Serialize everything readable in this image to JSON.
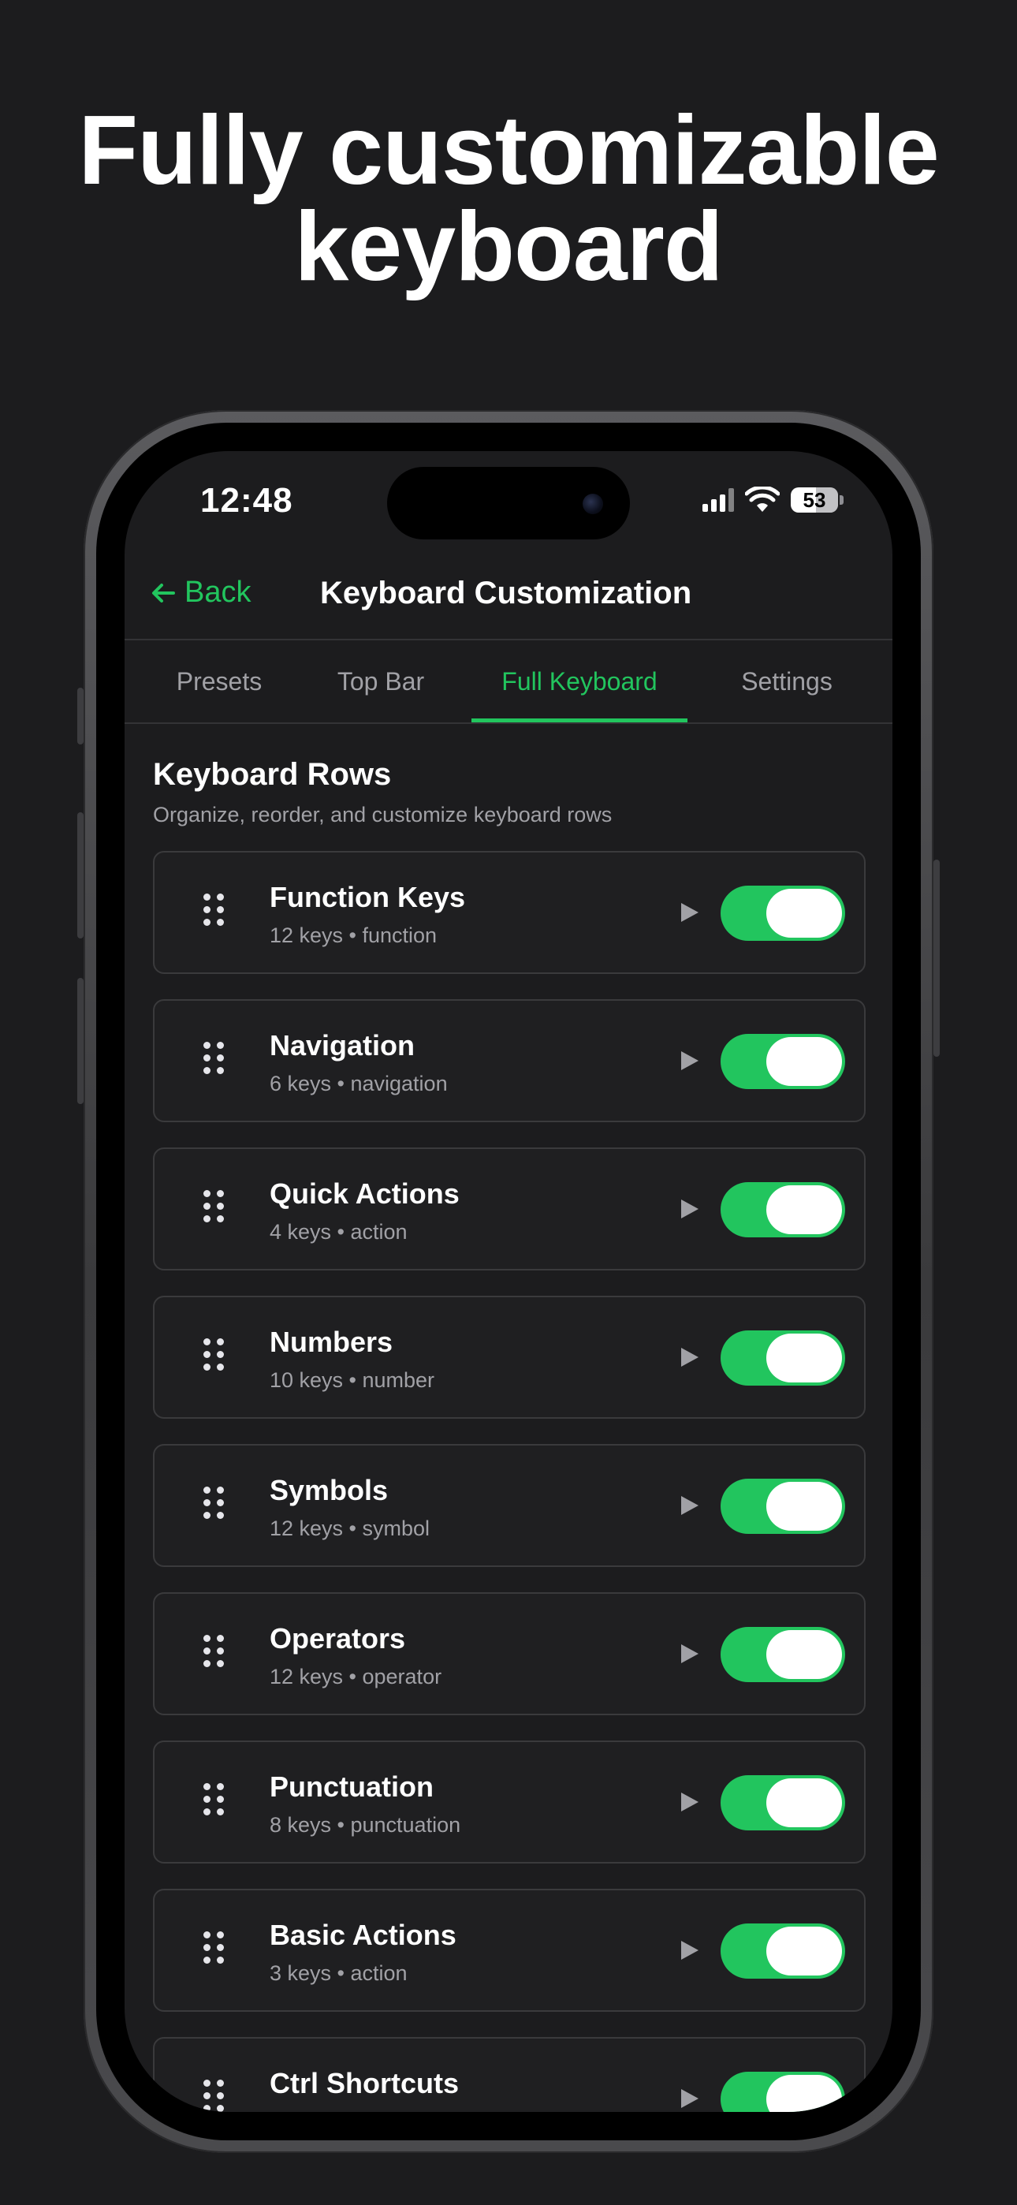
{
  "headline": {
    "line1": "Fully customizable",
    "line2": "keyboard"
  },
  "status_bar": {
    "time": "12:48",
    "battery": "53"
  },
  "nav": {
    "back_label": "Back",
    "back_icon": "arrow-left-icon",
    "title": "Keyboard Customization"
  },
  "tabs": [
    {
      "label": "Presets"
    },
    {
      "label": "Top Bar"
    },
    {
      "label": "Full Keyboard"
    },
    {
      "label": "Settings"
    }
  ],
  "active_tab": "Full Keyboard",
  "section": {
    "title": "Keyboard Rows",
    "subtitle": "Organize, reorder, and customize keyboard rows"
  },
  "rows": [
    {
      "name": "Function Keys",
      "meta": "12 keys • function",
      "enabled": true
    },
    {
      "name": "Navigation",
      "meta": "6 keys • navigation",
      "enabled": true
    },
    {
      "name": "Quick Actions",
      "meta": "4 keys • action",
      "enabled": true
    },
    {
      "name": "Numbers",
      "meta": "10 keys • number",
      "enabled": true
    },
    {
      "name": "Symbols",
      "meta": "12 keys • symbol",
      "enabled": true
    },
    {
      "name": "Operators",
      "meta": "12 keys • operator",
      "enabled": true
    },
    {
      "name": "Punctuation",
      "meta": "8 keys • punctuation",
      "enabled": true
    },
    {
      "name": "Basic Actions",
      "meta": "3 keys • action",
      "enabled": true
    },
    {
      "name": "Ctrl Shortcuts",
      "meta": "",
      "enabled": true
    }
  ],
  "colors": {
    "accent": "#22c55e",
    "background": "#1c1c1e",
    "card_border": "#3a3a3c",
    "secondary_text": "#a1a1a6"
  }
}
